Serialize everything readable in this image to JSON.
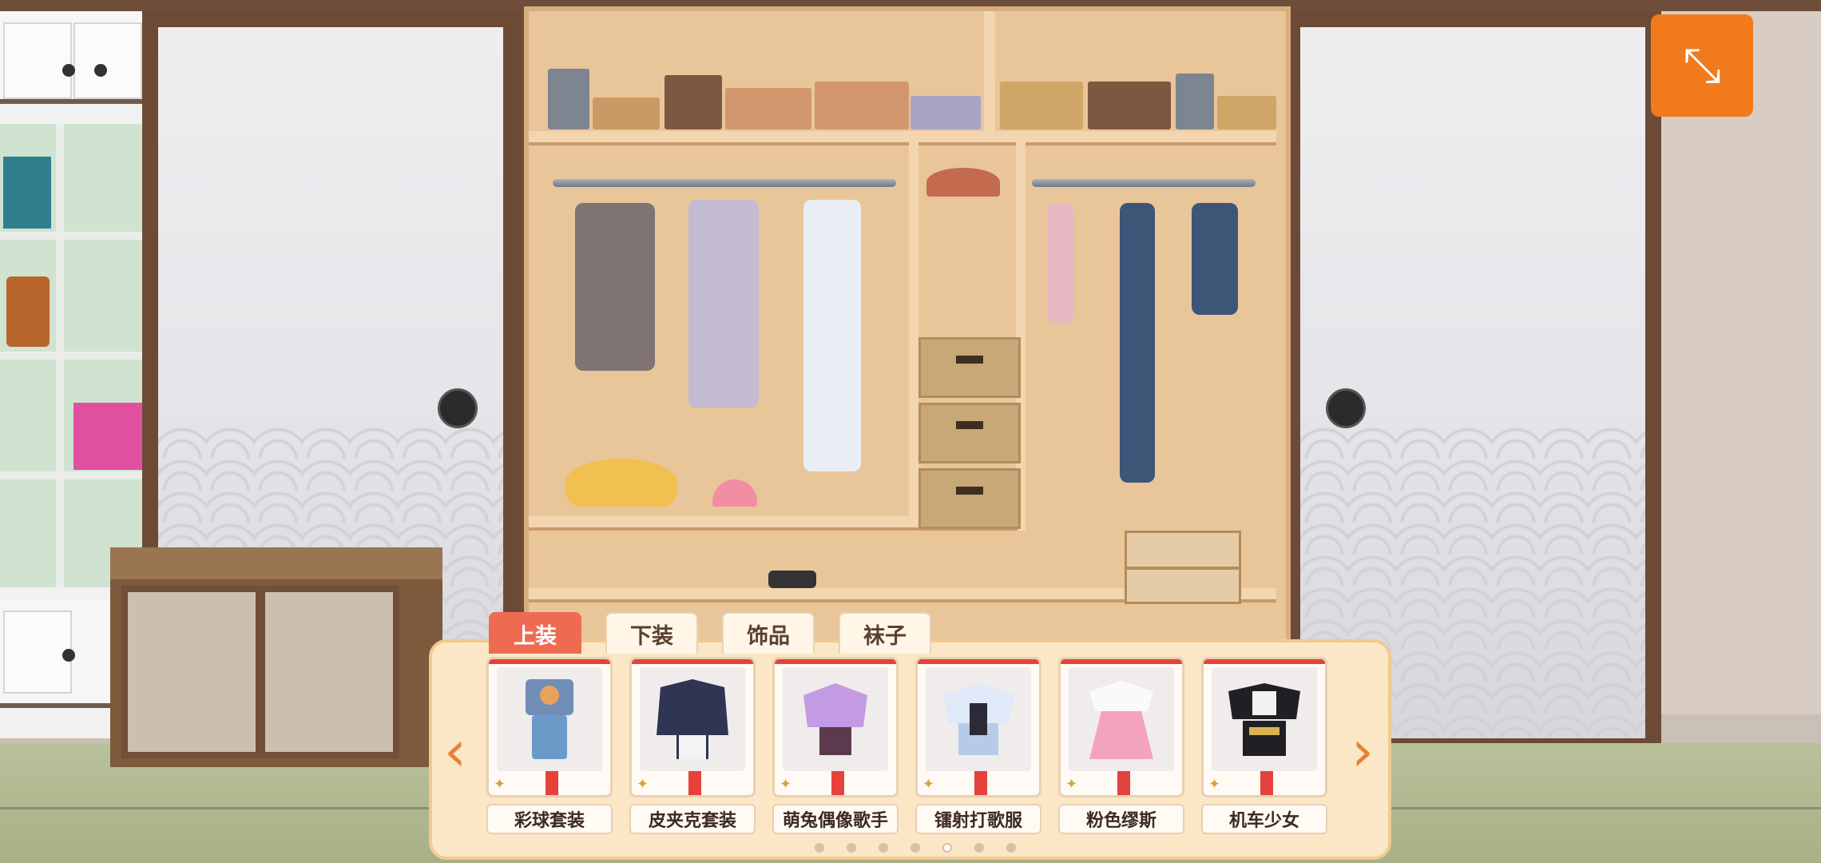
{
  "toggle_button": {
    "icon": "collapse-arrows-icon",
    "glyph": "⤡",
    "color": "#f07a1c"
  },
  "categories": {
    "active_index": 0,
    "tabs": [
      {
        "label": "上装"
      },
      {
        "label": "下装"
      },
      {
        "label": "饰品"
      },
      {
        "label": "袜子"
      }
    ]
  },
  "outfits": [
    {
      "name": "彩球套装",
      "icon": "shirt-overalls-icon"
    },
    {
      "name": "皮夹克套装",
      "icon": "leather-jacket-icon"
    },
    {
      "name": "萌兔偶像歌手",
      "icon": "idol-outfit-icon"
    },
    {
      "name": "镭射打歌服",
      "icon": "laser-outfit-icon"
    },
    {
      "name": "粉色缪斯",
      "icon": "pink-dress-icon"
    },
    {
      "name": "机车少女",
      "icon": "biker-outfit-icon"
    }
  ],
  "carousel": {
    "prev_glyph": "‹",
    "next_glyph": "›",
    "page_count": 7,
    "current_page": 5
  },
  "colors": {
    "accent": "#ee6b52",
    "panel": "#fbe6c6",
    "arrow": "#e8803a"
  }
}
